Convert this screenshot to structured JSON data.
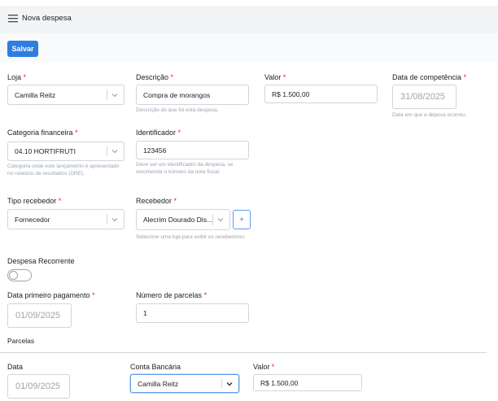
{
  "header": {
    "title": "Nova despesa",
    "menu_icon": "hamburger-icon"
  },
  "toolbar": {
    "save_label": "Salvar"
  },
  "colors": {
    "accent": "#2f7de1",
    "required": "#e11d48",
    "hint": "#9ca3af"
  },
  "form": {
    "loja": {
      "label": "Loja",
      "value": "Camilla Reitz"
    },
    "descricao": {
      "label": "Descrição",
      "value": "Compra de morangos",
      "hint": "Descrição do que foi esta despesa."
    },
    "valor": {
      "label": "Valor",
      "value": "R$ 1.500,00"
    },
    "data_competencia": {
      "label": "Data de competência",
      "value": "31/08/2025",
      "hint": "Data em que a depesa ocorreu."
    },
    "categoria": {
      "label": "Categoria financeira",
      "value": "04.10 HORTIFRUTI",
      "hint": "Categoria onde este lançamento é apresentado no relatório de resultados (DRE)."
    },
    "identificador": {
      "label": "Identificador",
      "value": "123456",
      "hint": "Deve ser um identificador da despesa, se recomenda o número da nota fiscal."
    },
    "tipo_recebedor": {
      "label": "Tipo recebedor",
      "value": "Fornecedor"
    },
    "recebedor": {
      "label": "Recebedor",
      "value": "Alecrim Dourado Dis...",
      "hint": "Selecione uma loja para exibir os recebedores",
      "add_label": "+"
    },
    "recorrente": {
      "label": "Despesa Recorrente",
      "checked": false
    },
    "data_primeiro_pagamento": {
      "label": "Data primeiro pagamento",
      "value": "01/09/2025"
    },
    "numero_parcelas": {
      "label": "Número de parcelas",
      "value": "1"
    }
  },
  "parcelas": {
    "section_label": "Parcelas",
    "columns": {
      "data": "Data",
      "conta": "Conta Bancária",
      "valor": "Valor"
    },
    "rows": [
      {
        "data": "01/09/2025",
        "conta": "Camilla Reitz",
        "valor": "R$ 1.500,00"
      }
    ]
  },
  "required_mark": "*"
}
